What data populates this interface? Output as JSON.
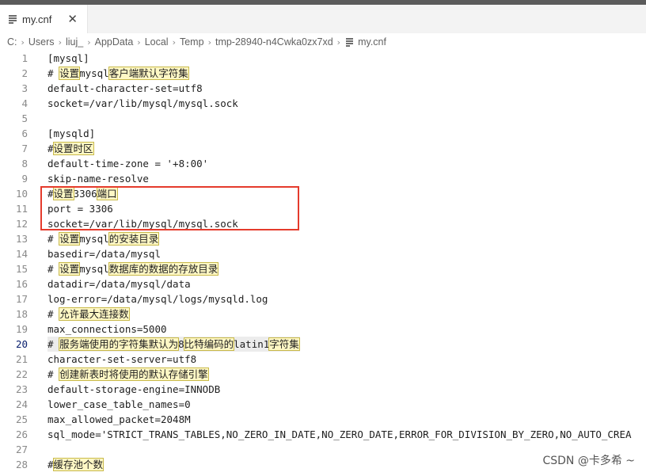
{
  "tab": {
    "title": "my.cnf",
    "close_glyph": "✕",
    "icon": "lines-icon"
  },
  "breadcrumb": {
    "segments": [
      "C:",
      "Users",
      "liuj_",
      "AppData",
      "Local",
      "Temp",
      "tmp-28940-n4Cwka0zx7xd"
    ],
    "file": "my.cnf",
    "separator": "›"
  },
  "editor": {
    "active_line": 20,
    "lines": [
      {
        "n": "1",
        "text": "[mysql]"
      },
      {
        "n": "2",
        "pre": "# ",
        "cjk": "设置",
        "mid": "mysql",
        "cjk2": "客户端默认字符集"
      },
      {
        "n": "3",
        "text": "default-character-set=utf8"
      },
      {
        "n": "4",
        "text": "socket=/var/lib/mysql/mysql.sock"
      },
      {
        "n": "5",
        "text": ""
      },
      {
        "n": "6",
        "text": "[mysqld]"
      },
      {
        "n": "7",
        "pre": "#",
        "cjk": "设置时区"
      },
      {
        "n": "8",
        "text": "default-time-zone = '+8:00'"
      },
      {
        "n": "9",
        "text": "skip-name-resolve"
      },
      {
        "n": "10",
        "pre": "#",
        "cjk": "设置",
        "mid": "3306",
        "cjk2": "端口"
      },
      {
        "n": "11",
        "text": "port = 3306"
      },
      {
        "n": "12",
        "text": "socket=/var/lib/mysql/mysql.sock"
      },
      {
        "n": "13",
        "pre": "# ",
        "cjk": "设置",
        "mid": "mysql",
        "cjk2": "的安装目录"
      },
      {
        "n": "14",
        "text": "basedir=/data/mysql"
      },
      {
        "n": "15",
        "pre": "# ",
        "cjk": "设置",
        "mid": "mysql",
        "cjk2": "数据库的数据的存放目录"
      },
      {
        "n": "16",
        "text": "datadir=/data/mysql/data"
      },
      {
        "n": "17",
        "text": "log-error=/data/mysql/logs/mysqld.log"
      },
      {
        "n": "18",
        "pre": "# ",
        "cjk": "允许最大连接数"
      },
      {
        "n": "19",
        "text": "max_connections=5000"
      },
      {
        "n": "20",
        "pre": "# ",
        "cjk": "服务端使用的字符集默认为",
        "mid": "8",
        "cjk2": "比特编码的",
        "mid2": "latin1",
        "cjk3": "字符集"
      },
      {
        "n": "21",
        "text": "character-set-server=utf8"
      },
      {
        "n": "22",
        "pre": "# ",
        "cjk": "创建新表时将使用的默认存储引擎"
      },
      {
        "n": "23",
        "text": "default-storage-engine=INNODB"
      },
      {
        "n": "24",
        "text": "lower_case_table_names=0"
      },
      {
        "n": "25",
        "text": "max_allowed_packet=2048M"
      },
      {
        "n": "26",
        "text": "sql_mode='STRICT_TRANS_TABLES,NO_ZERO_IN_DATE,NO_ZERO_DATE,ERROR_FOR_DIVISION_BY_ZERO,NO_AUTO_CREA"
      },
      {
        "n": "27",
        "text": ""
      },
      {
        "n": "28",
        "pre": "#",
        "cjk": "缓存池个数"
      }
    ]
  },
  "watermark": "CSDN @卡多希 ~",
  "colors": {
    "highlight_box": "#e53b2c",
    "cjk_bg": "#fff8c5",
    "active_line_bg": "#ececec"
  }
}
